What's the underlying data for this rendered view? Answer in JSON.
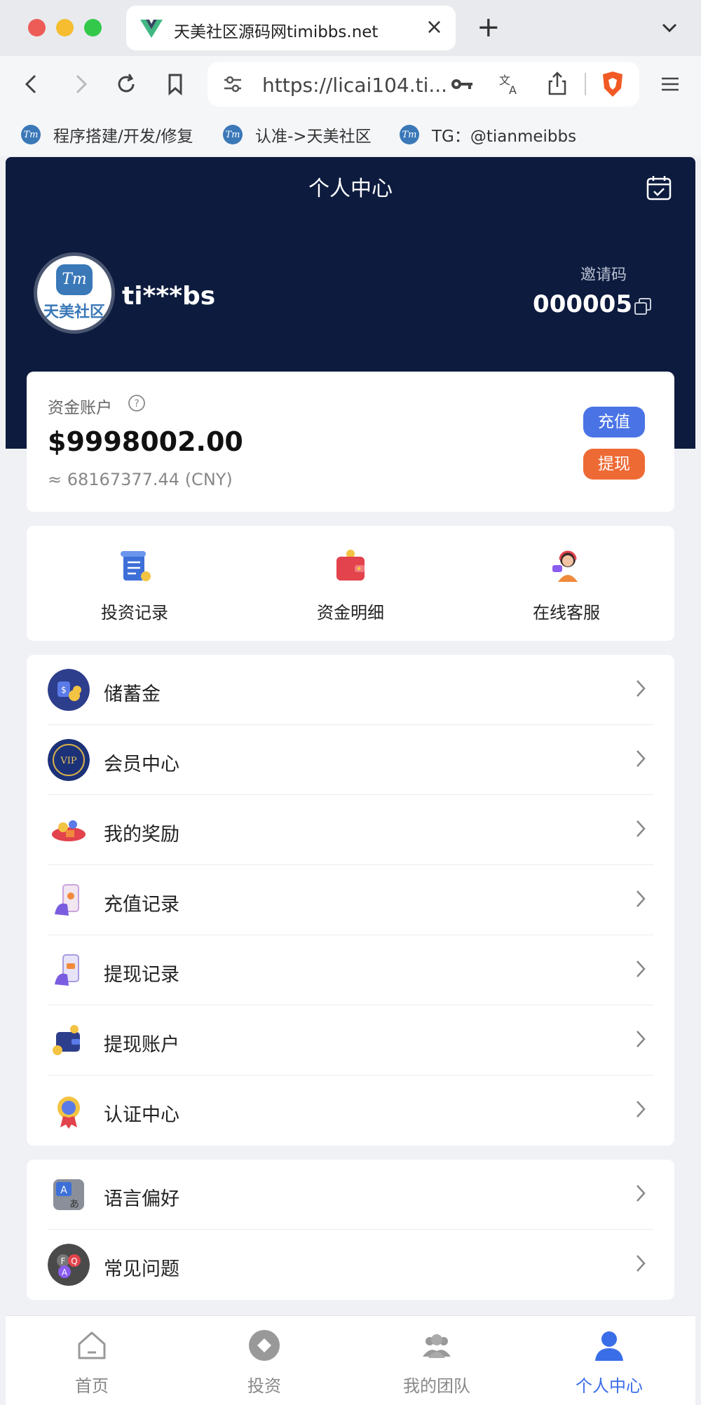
{
  "browser": {
    "tab_title": "天美社区源码网timibbs.net",
    "tab_close": "×",
    "new_tab": "+",
    "url": "https://licai104.ti...",
    "bookmarks": [
      {
        "label": "程序搭建/开发/修复",
        "icon": "Tm"
      },
      {
        "label": "认准->天美社区",
        "icon": "Tm"
      },
      {
        "label": "TG：@tianmeibbs",
        "icon": "Tm"
      }
    ]
  },
  "header": {
    "title": "个人中心",
    "avatar_mark": "Tm",
    "avatar_text": "天美社区",
    "username": "ti***bs",
    "invite_label": "邀请码",
    "invite_code": "000005"
  },
  "account": {
    "label": "资金账户",
    "amount": "$9998002.00",
    "cny": "≈ 68167377.44 (CNY)",
    "recharge_label": "充值",
    "withdraw_label": "提现"
  },
  "quick_links": [
    {
      "label": "投资记录",
      "icon": "scroll-icon"
    },
    {
      "label": "资金明细",
      "icon": "wallet-icon"
    },
    {
      "label": "在线客服",
      "icon": "support-agent-icon"
    }
  ],
  "menu": [
    {
      "label": "储蓄金",
      "icon": "savings-icon"
    },
    {
      "label": "会员中心",
      "icon": "vip-icon"
    },
    {
      "label": "我的奖励",
      "icon": "reward-icon"
    },
    {
      "label": "充值记录",
      "icon": "recharge-record-icon"
    },
    {
      "label": "提现记录",
      "icon": "withdraw-record-icon"
    },
    {
      "label": "提现账户",
      "icon": "withdraw-account-icon"
    },
    {
      "label": "认证中心",
      "icon": "certification-icon"
    }
  ],
  "menu2": [
    {
      "label": "语言偏好",
      "icon": "language-icon"
    },
    {
      "label": "常见问题",
      "icon": "faq-icon"
    }
  ],
  "bottom_nav": [
    {
      "label": "首页",
      "icon": "home-icon"
    },
    {
      "label": "投资",
      "icon": "invest-icon"
    },
    {
      "label": "我的团队",
      "icon": "team-icon"
    },
    {
      "label": "个人中心",
      "icon": "profile-icon",
      "active": true
    }
  ],
  "colors": {
    "header_bg": "#0d1b3e",
    "recharge": "#4a74e6",
    "withdraw": "#ee6a35",
    "active_nav": "#3a6ee8"
  }
}
